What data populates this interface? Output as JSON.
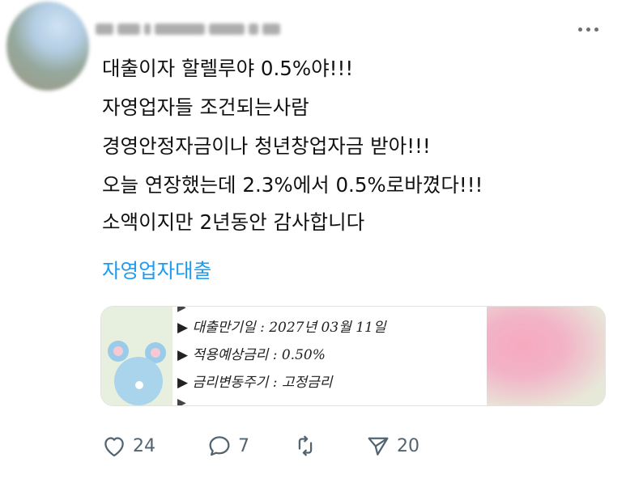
{
  "post": {
    "username": "",
    "text_lines": [
      "대출이자 할렐루야 0.5%야!!!",
      "자영업자들 조건되는사람",
      "경영안정자금이나 청년창업자금 받아!!!",
      "오늘 연장했는데 2.3%에서 0.5%로바꼈다!!!",
      "소액이지만 2년동안 감사합니다"
    ],
    "hashtag": "자영업자대출"
  },
  "media": {
    "doc_lines": [
      "▶ 대출만기일 : 2027년 03월 11일",
      "▶ 적용예상금리 : 0.50%",
      "▶ 금리변동주기 : 고정금리"
    ]
  },
  "actions": {
    "likes": "24",
    "replies": "7",
    "reposts": "",
    "shares": "20"
  },
  "icons": {
    "avatar": "blurred-avatar",
    "more": "ellipsis-icon",
    "like": "heart-icon",
    "reply": "speech-bubble-icon",
    "repost": "repost-icon",
    "share": "send-icon"
  },
  "colors": {
    "link": "#1d9bf0",
    "text": "#111111",
    "icon": "#536471"
  }
}
